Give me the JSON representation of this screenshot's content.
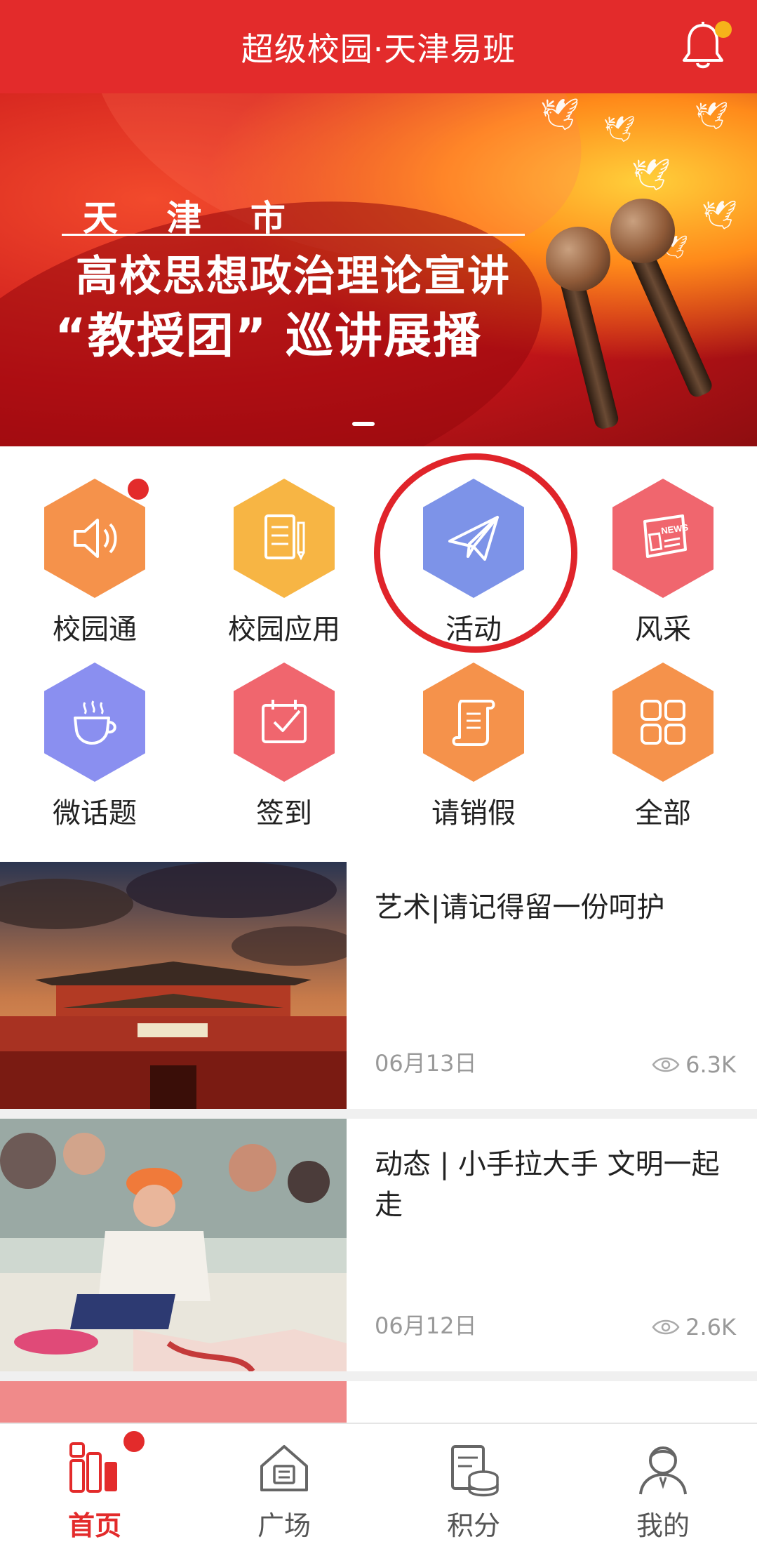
{
  "header": {
    "title": "超级校园·天津易班",
    "bell_icon": "bell-icon",
    "badge_color": "#f6b21a",
    "brand_color": "#e32b2b"
  },
  "banner": {
    "city": "天 津 市",
    "line1": "高校思想政治理论宣讲",
    "line2": "“教授团” 巡讲展播"
  },
  "grid": [
    {
      "label": "校园通",
      "icon": "speaker-icon",
      "color": "#f5924b",
      "badge": true
    },
    {
      "label": "校园应用",
      "icon": "document-icon",
      "color": "#f7b544",
      "badge": false
    },
    {
      "label": "活动",
      "icon": "paper-plane-icon",
      "color": "#7d93e8",
      "badge": false
    },
    {
      "label": "风采",
      "icon": "newspaper-icon",
      "color": "#f0666e",
      "badge": false
    },
    {
      "label": "微话题",
      "icon": "coffee-cup-icon",
      "color": "#8a8ff0",
      "badge": false
    },
    {
      "label": "签到",
      "icon": "calendar-check-icon",
      "color": "#f0666e",
      "badge": false
    },
    {
      "label": "请销假",
      "icon": "scroll-icon",
      "color": "#f5924b",
      "badge": false
    },
    {
      "label": "全部",
      "icon": "grid-icon",
      "color": "#f5924b",
      "badge": false
    }
  ],
  "news": [
    {
      "title": "艺术|请记得留一份呵护",
      "date": "06月13日",
      "views": "6.3K"
    },
    {
      "title": "动态 | 小手拉大手 文明一起走",
      "date": "06月12日",
      "views": "2.6K"
    }
  ],
  "nav": [
    {
      "label": "首页",
      "icon": "home-blocks-icon",
      "active": true
    },
    {
      "label": "广场",
      "icon": "square-house-icon",
      "active": false
    },
    {
      "label": "积分",
      "icon": "points-coins-icon",
      "active": false
    },
    {
      "label": "我的",
      "icon": "profile-person-icon",
      "active": false
    }
  ]
}
